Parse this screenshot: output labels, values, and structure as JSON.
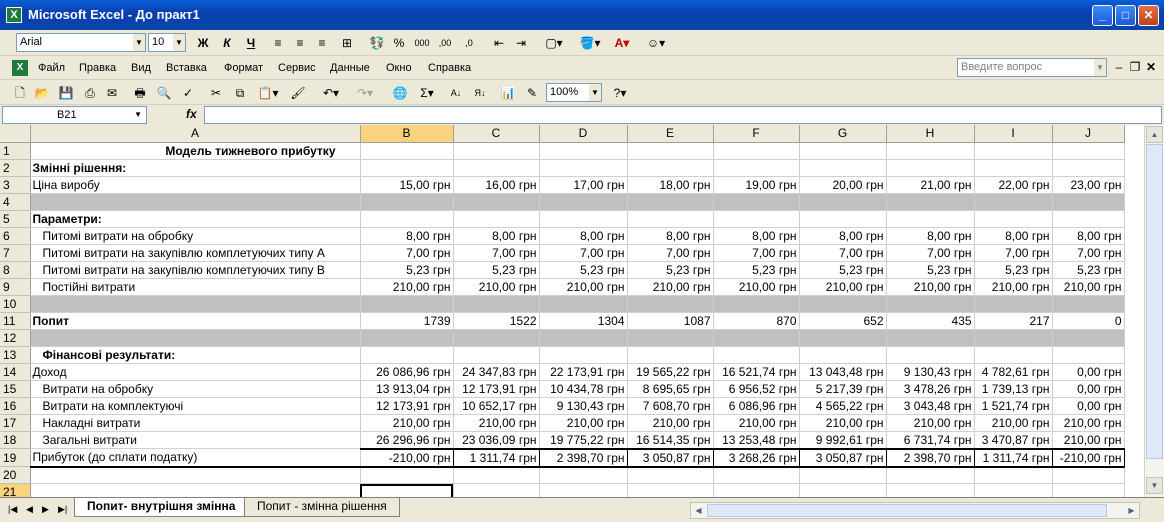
{
  "window": {
    "title": "Microsoft Excel - До практ1"
  },
  "format_toolbar": {
    "font": "Arial",
    "font_size": "10",
    "bold": "Ж",
    "italic": "К",
    "underline": "Ч",
    "percent": "%",
    "thousands": "000"
  },
  "menu": [
    "Файл",
    "Правка",
    "Вид",
    "Вставка",
    "Формат",
    "Сервис",
    "Данные",
    "Окно",
    "Справка"
  ],
  "help_box": {
    "placeholder": "Введите вопрос"
  },
  "standard_toolbar": {
    "zoom": "100%",
    "sigma": "Σ"
  },
  "formula_bar": {
    "name_box": "B21",
    "fx": "fx",
    "formula": ""
  },
  "columns": [
    "A",
    "B",
    "C",
    "D",
    "E",
    "F",
    "G",
    "H",
    "I",
    "J"
  ],
  "rows": [
    {
      "n": "1",
      "type": "title",
      "a": "Модель тижневого прибутку",
      "v": [
        "",
        "",
        "",
        "",
        "",
        "",
        "",
        "",
        ""
      ]
    },
    {
      "n": "2",
      "type": "header",
      "a": "Змінні рішення:",
      "v": [
        "",
        "",
        "",
        "",
        "",
        "",
        "",
        "",
        ""
      ]
    },
    {
      "n": "3",
      "type": "normal",
      "a": "Ціна виробу",
      "v": [
        "15,00 грн",
        "16,00 грн",
        "17,00 грн",
        "18,00 грн",
        "19,00 грн",
        "20,00 грн",
        "21,00 грн",
        "22,00 грн",
        "23,00 грн"
      ]
    },
    {
      "n": "4",
      "type": "gray",
      "a": "",
      "v": [
        "",
        "",
        "",
        "",
        "",
        "",
        "",
        "",
        ""
      ]
    },
    {
      "n": "5",
      "type": "header",
      "a": "Параметри:",
      "v": [
        "",
        "",
        "",
        "",
        "",
        "",
        "",
        "",
        ""
      ]
    },
    {
      "n": "6",
      "type": "indent",
      "a": "Питомі витрати на обробку",
      "v": [
        "8,00 грн",
        "8,00 грн",
        "8,00 грн",
        "8,00 грн",
        "8,00 грн",
        "8,00 грн",
        "8,00 грн",
        "8,00 грн",
        "8,00 грн"
      ]
    },
    {
      "n": "7",
      "type": "indent",
      "a": "Питомі витрати на закупівлю комплетуючих типу А",
      "v": [
        "7,00 грн",
        "7,00 грн",
        "7,00 грн",
        "7,00 грн",
        "7,00 грн",
        "7,00 грн",
        "7,00 грн",
        "7,00 грн",
        "7,00 грн"
      ]
    },
    {
      "n": "8",
      "type": "indent",
      "a": "Питомі витрати на закупівлю комплетуючих типу В",
      "v": [
        "5,23 грн",
        "5,23 грн",
        "5,23 грн",
        "5,23 грн",
        "5,23 грн",
        "5,23 грн",
        "5,23 грн",
        "5,23 грн",
        "5,23 грн"
      ]
    },
    {
      "n": "9",
      "type": "indent",
      "a": "Постійні витрати",
      "v": [
        "210,00 грн",
        "210,00 грн",
        "210,00 грн",
        "210,00 грн",
        "210,00 грн",
        "210,00 грн",
        "210,00 грн",
        "210,00 грн",
        "210,00 грн"
      ]
    },
    {
      "n": "10",
      "type": "gray",
      "a": "",
      "v": [
        "",
        "",
        "",
        "",
        "",
        "",
        "",
        "",
        ""
      ]
    },
    {
      "n": "11",
      "type": "header",
      "a": "Попит",
      "v": [
        "1739",
        "1522",
        "1304",
        "1087",
        "870",
        "652",
        "435",
        "217",
        "0"
      ]
    },
    {
      "n": "12",
      "type": "gray",
      "a": "",
      "v": [
        "",
        "",
        "",
        "",
        "",
        "",
        "",
        "",
        ""
      ]
    },
    {
      "n": "13",
      "type": "header-indent",
      "a": "Фінансові результати:",
      "v": [
        "",
        "",
        "",
        "",
        "",
        "",
        "",
        "",
        ""
      ]
    },
    {
      "n": "14",
      "type": "normal",
      "a": "Доход",
      "v": [
        "26 086,96 грн",
        "24 347,83 грн",
        "22 173,91 грн",
        "19 565,22 грн",
        "16 521,74 грн",
        "13 043,48 грн",
        "9 130,43 грн",
        "4 782,61 грн",
        "0,00 грн"
      ]
    },
    {
      "n": "15",
      "type": "indent",
      "a": "Витрати на обробку",
      "v": [
        "13 913,04 грн",
        "12 173,91 грн",
        "10 434,78 грн",
        "8 695,65 грн",
        "6 956,52 грн",
        "5 217,39 грн",
        "3 478,26 грн",
        "1 739,13 грн",
        "0,00 грн"
      ]
    },
    {
      "n": "16",
      "type": "indent",
      "a": "Витрати на комплектуючі",
      "v": [
        "12 173,91 грн",
        "10 652,17 грн",
        "9 130,43 грн",
        "7 608,70 грн",
        "6 086,96 грн",
        "4 565,22 грн",
        "3 043,48 грн",
        "1 521,74 грн",
        "0,00 грн"
      ]
    },
    {
      "n": "17",
      "type": "indent",
      "a": "Накладні витрати",
      "v": [
        "210,00 грн",
        "210,00 грн",
        "210,00 грн",
        "210,00 грн",
        "210,00 грн",
        "210,00 грн",
        "210,00 грн",
        "210,00 грн",
        "210,00 грн"
      ]
    },
    {
      "n": "18",
      "type": "indent-tot",
      "a": "Загальні витрати",
      "v": [
        "26 296,96 грн",
        "23 036,09 грн",
        "19 775,22 грн",
        "16 514,35 грн",
        "13 253,48 грн",
        "9 992,61 грн",
        "6 731,74 грн",
        "3 470,87 грн",
        "210,00 грн"
      ]
    },
    {
      "n": "19",
      "type": "profit",
      "a": "Прибуток (до сплати податку)",
      "v": [
        "-210,00 грн",
        "1 311,74 грн",
        "2 398,70 грн",
        "3 050,87 грн",
        "3 268,26 грн",
        "3 050,87 грн",
        "2 398,70 грн",
        "1 311,74 грн",
        "-210,00 грн"
      ]
    },
    {
      "n": "20",
      "type": "normal",
      "a": "",
      "v": [
        "",
        "",
        "",
        "",
        "",
        "",
        "",
        "",
        ""
      ]
    },
    {
      "n": "21",
      "type": "normal",
      "a": "",
      "v": [
        "",
        "",
        "",
        "",
        "",
        "",
        "",
        "",
        ""
      ]
    }
  ],
  "sheet_tabs": [
    "Попит- внутрішня змінна",
    "Попит - змінна рішення"
  ],
  "colors": {
    "gray_row": "#c0c0c0",
    "selected_header": "#fbd37c",
    "title_bar": "#0a5fd8"
  }
}
